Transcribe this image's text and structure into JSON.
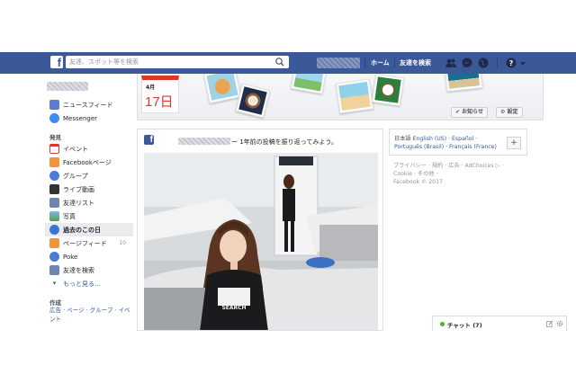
{
  "search": {
    "placeholder": "友達、スポット等を検索"
  },
  "header": {
    "home_label": "ホーム",
    "find_friends_label": "友達を検索"
  },
  "sidebar": {
    "top_items": [
      {
        "label": "ニュースフィード",
        "icon": "news-feed-icon"
      },
      {
        "label": "Messenger",
        "icon": "messenger-icon"
      }
    ],
    "explore_heading": "発見",
    "explore_items": [
      {
        "label": "イベント",
        "icon": "calendar-icon"
      },
      {
        "label": "Facebookページ",
        "icon": "flag-icon"
      },
      {
        "label": "グループ",
        "icon": "groups-icon"
      },
      {
        "label": "ライブ動画",
        "icon": "live-video-icon"
      },
      {
        "label": "友達リスト",
        "icon": "friend-list-icon"
      },
      {
        "label": "写真",
        "icon": "photos-icon"
      },
      {
        "label": "過去のこの日",
        "icon": "on-this-day-icon",
        "active": true
      },
      {
        "label": "ページフィード",
        "icon": "pages-feed-icon",
        "count": "10"
      },
      {
        "label": "Poke",
        "icon": "poke-icon"
      },
      {
        "label": "友達を検索",
        "icon": "find-friends-icon"
      }
    ],
    "see_more": "もっと見る...",
    "create_heading": "作成",
    "create_links": "広告 · ページ · グループ · イベント"
  },
  "banner": {
    "calendar_month": "4月",
    "calendar_day": "17日",
    "notification_button": "お知らせ",
    "settings_button": "設定"
  },
  "post": {
    "text": "ー 1年前の投稿を振り返ってみよう。"
  },
  "languages": {
    "current": "日本語",
    "line1": "English (US) · Español ·",
    "line2": "Português (Brasil) · Français (France)",
    "add_button": "+"
  },
  "footer": {
    "line1": "プライバシー · 規約 · 広告 · AdChoices ▷ ·",
    "line2": "Cookie · その他 ·",
    "line3": "Facebook © 2017"
  },
  "chat": {
    "label": "チャット (7)"
  },
  "colors": {
    "brand": "#3b5998",
    "accent_red": "#d9392b",
    "online": "#42b72a"
  }
}
